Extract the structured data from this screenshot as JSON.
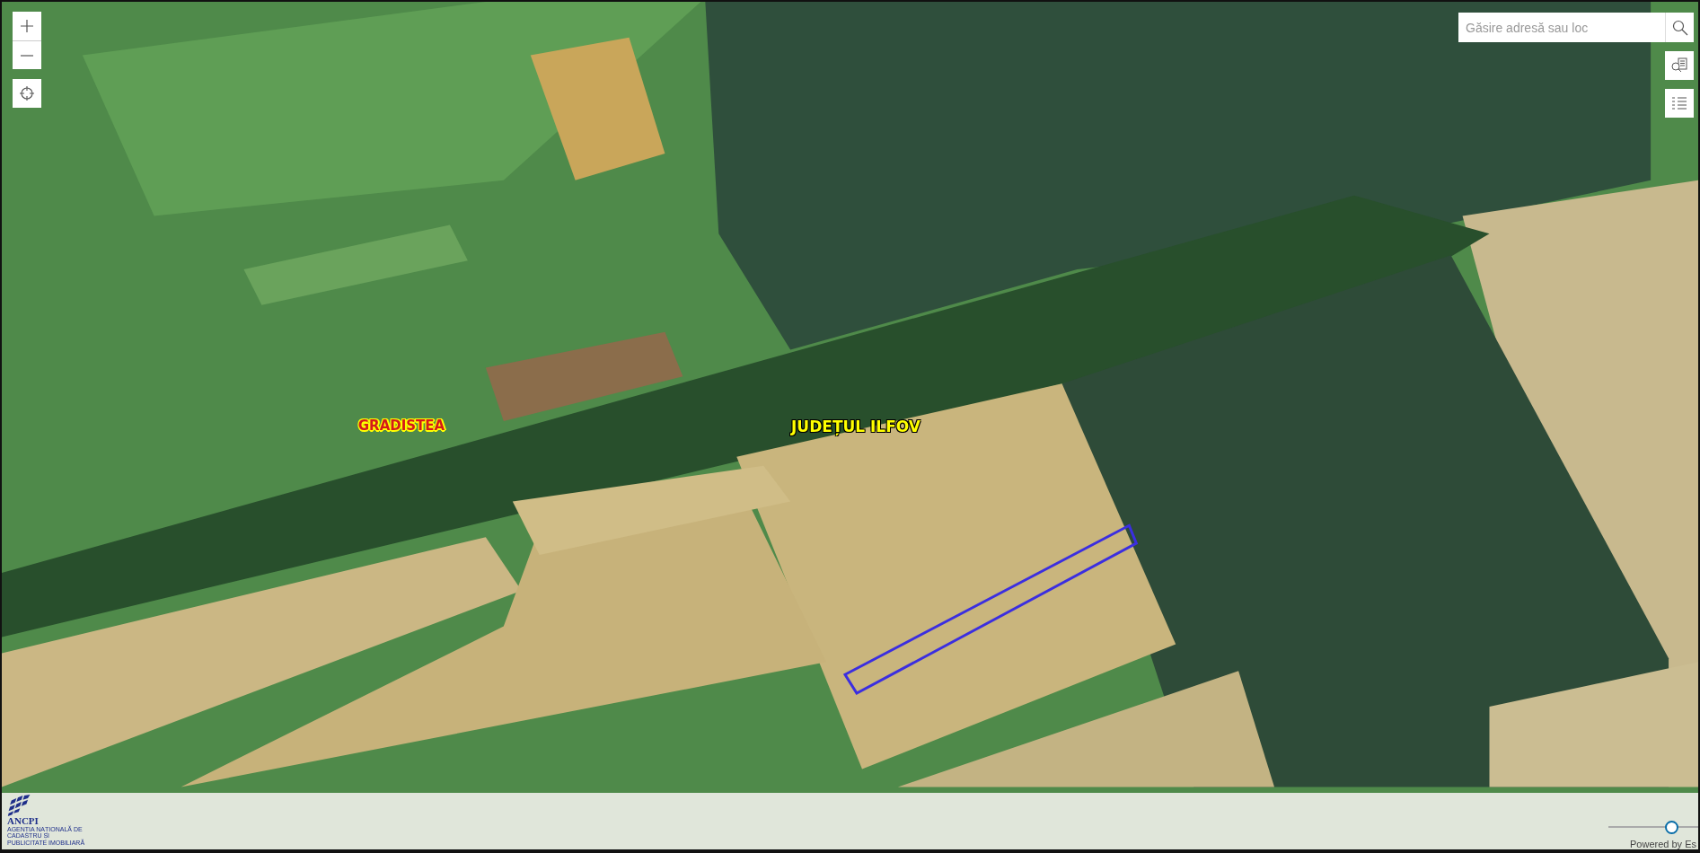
{
  "map": {
    "labels": [
      {
        "kind": "locality",
        "text": "GRADISTEA"
      },
      {
        "kind": "county",
        "text": "JUDEȚUL ILFOV"
      }
    ]
  },
  "search": {
    "placeholder": "Găsire adresă sau loc"
  },
  "logo": {
    "name": "ANCPI",
    "subtitle": "AGENȚIA NAȚIONALĂ DE CADASTRU ȘI PUBLICITATE IMOBILIARĂ"
  },
  "slider": {
    "level": 0.7
  },
  "attribution": "Powered by Es"
}
